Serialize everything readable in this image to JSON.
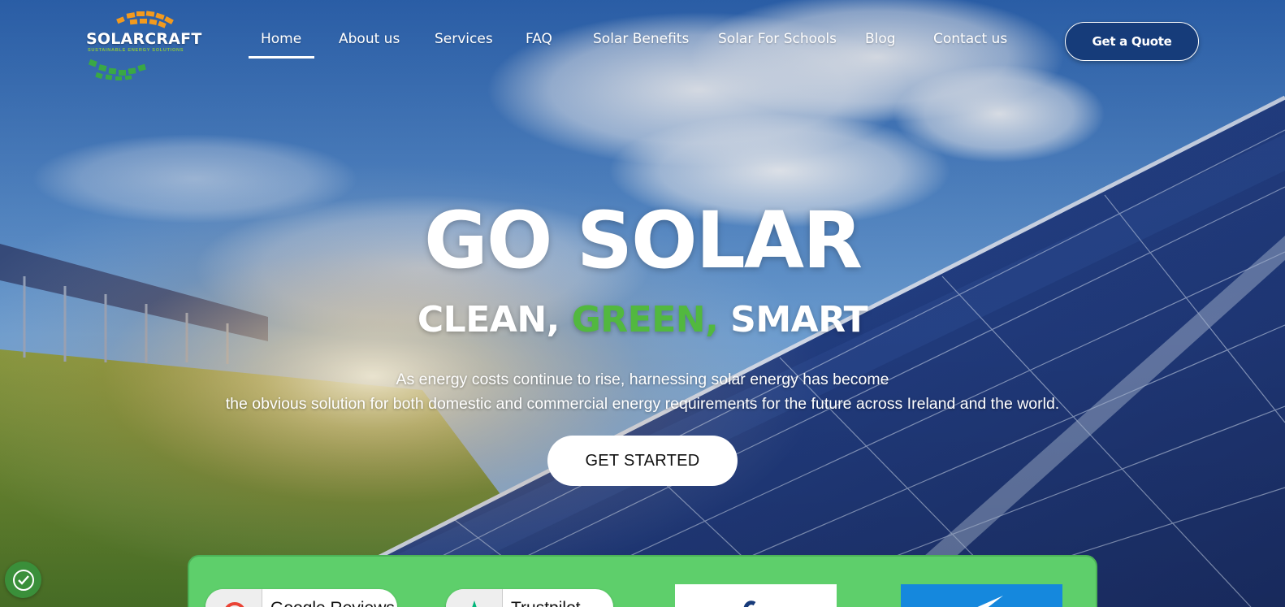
{
  "brand": {
    "name": "SOLARCRAFT",
    "tagline": "SUSTAINABLE ENERGY SOLUTIONS",
    "accent": "#52b83f",
    "navy": "#163c7a"
  },
  "nav": {
    "items": [
      {
        "label": "Home",
        "active": true
      },
      {
        "label": "About us"
      },
      {
        "label": "Services"
      },
      {
        "label": "FAQ"
      },
      {
        "label": "Solar Benefits"
      },
      {
        "label": "Solar For Schools"
      },
      {
        "label": "Blog"
      },
      {
        "label": "Contact us"
      }
    ],
    "quote_label": "Get a Quote"
  },
  "hero": {
    "title": "GO SOLAR",
    "subtitle_part1": "CLEAN, ",
    "subtitle_green": "GREEN,",
    "subtitle_part2": " SMART",
    "desc_line1": "As energy costs continue to rise, harnessing solar energy has become",
    "desc_line2": "the obvious solution for both domestic and commercial energy requirements for the future across Ireland and the world.",
    "cta_label": "GET STARTED"
  },
  "reviews": {
    "google_label": "Google Reviews",
    "trustpilot_label": "Trustpilot",
    "strip_color": "#5ecf6b"
  },
  "icons": {
    "cookie": "cookie-settings-icon",
    "google": "google-icon",
    "trustpilot": "trustpilot-star-icon"
  }
}
